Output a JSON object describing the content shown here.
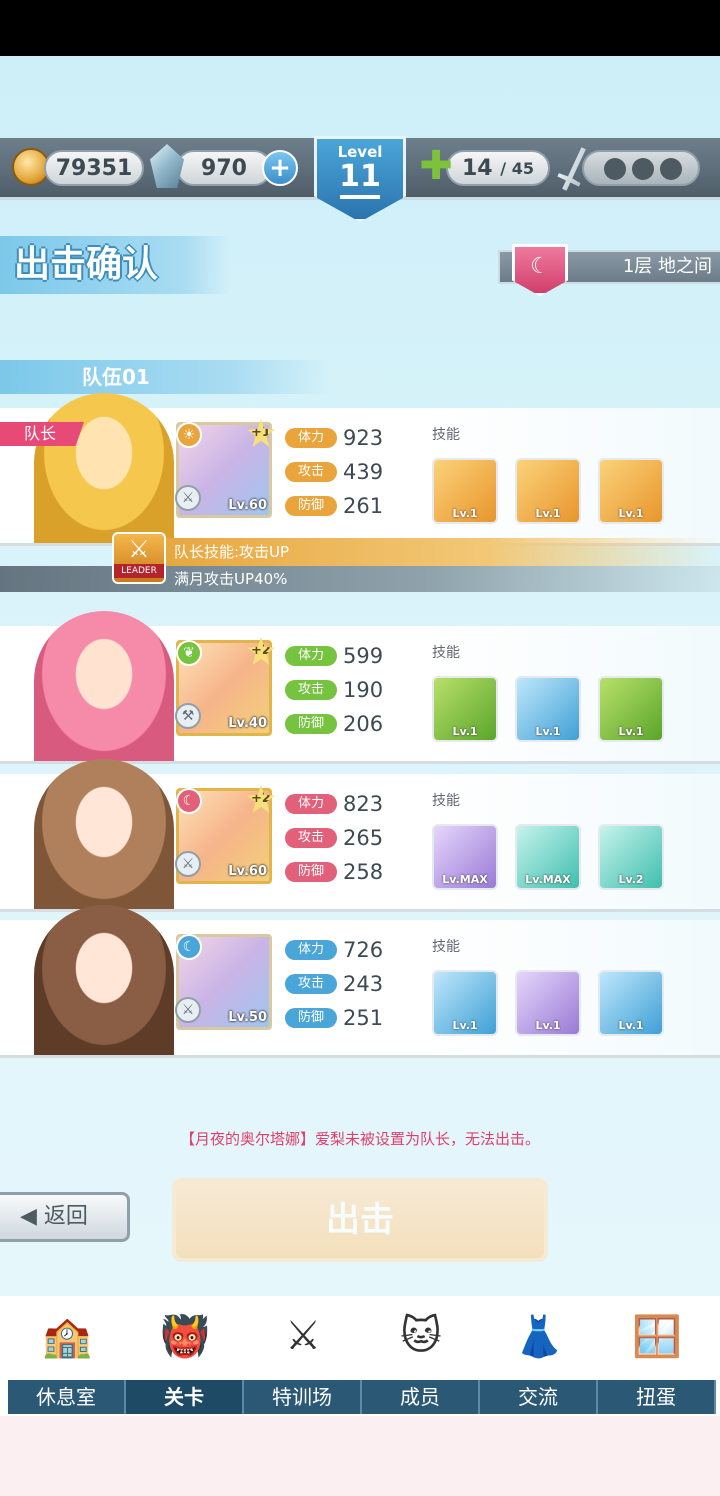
{
  "resources": {
    "coins": "79351",
    "gems": "970",
    "stamina": "14",
    "stamina_max": "/ 45"
  },
  "level": {
    "label": "Level",
    "value": "11"
  },
  "page_title": "出击确认",
  "floor": {
    "text": "1层  地之间"
  },
  "team_name": "队伍01",
  "leader_tag": "队长",
  "leader_skill": {
    "title": "队长技能:攻击UP",
    "desc": "满月攻击UP40%",
    "badge": "LEADER"
  },
  "stat_labels": {
    "hp": "体力",
    "atk": "攻击",
    "def": "防御"
  },
  "skills_label": "技能",
  "members": [
    {
      "hp": "923",
      "atk": "439",
      "def": "261",
      "level": "Lv.60",
      "plus": "+1",
      "skills": [
        {
          "lv": "Lv.1"
        },
        {
          "lv": "Lv.1"
        },
        {
          "lv": "Lv.1"
        }
      ]
    },
    {
      "hp": "599",
      "atk": "190",
      "def": "206",
      "level": "Lv.40",
      "plus": "+2",
      "skills": [
        {
          "lv": "Lv.1"
        },
        {
          "lv": "Lv.1"
        },
        {
          "lv": "Lv.1"
        }
      ]
    },
    {
      "hp": "823",
      "atk": "265",
      "def": "258",
      "level": "Lv.60",
      "plus": "+2",
      "skills": [
        {
          "lv": "Lv.MAX"
        },
        {
          "lv": "Lv.MAX"
        },
        {
          "lv": "Lv.2"
        }
      ]
    },
    {
      "hp": "726",
      "atk": "243",
      "def": "251",
      "level": "Lv.50",
      "plus": "",
      "skills": [
        {
          "lv": "Lv.1"
        },
        {
          "lv": "Lv.1"
        },
        {
          "lv": "Lv.1"
        }
      ]
    }
  ],
  "warning": "【月夜的奥尔塔娜】爱梨未被设置为队长，无法出击。",
  "back_button": "返回",
  "sortie_button": "出击",
  "nav": [
    {
      "label": "休息室",
      "icon": "school-icon"
    },
    {
      "label": "关卡",
      "icon": "demon-icon"
    },
    {
      "label": "特训场",
      "icon": "crossed-swords-icon"
    },
    {
      "label": "成员",
      "icon": "cat-mask-icon"
    },
    {
      "label": "交流",
      "icon": "uniform-icon"
    },
    {
      "label": "扭蛋",
      "icon": "curtain-icon"
    }
  ],
  "nav_active": "关卡",
  "colors": {
    "accent": "#4aa6d9",
    "hp_label": "#e9a53c",
    "warning": "#e0406a",
    "nav_bg": "#2a5875"
  }
}
